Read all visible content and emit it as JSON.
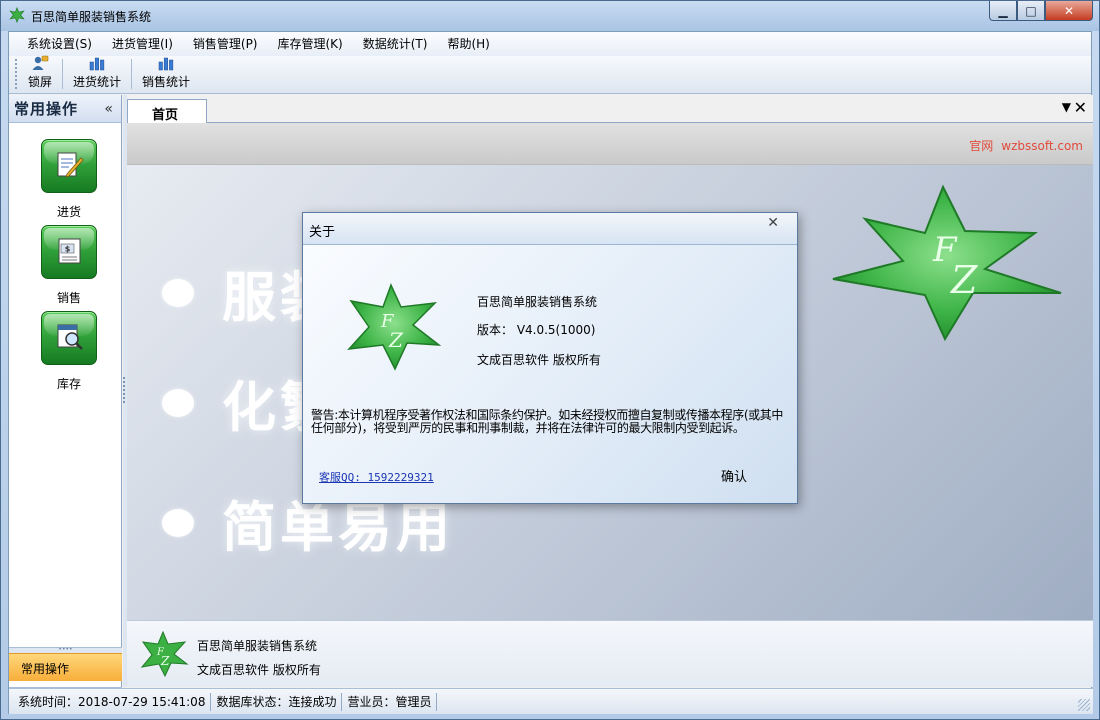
{
  "window": {
    "title": "百思简单服装销售系统",
    "min_glyph": "▁",
    "max_glyph": "□",
    "close_glyph": "✕"
  },
  "menu": [
    "系统设置(S)",
    "进货管理(I)",
    "销售管理(P)",
    "库存管理(K)",
    "数据统计(T)",
    "帮助(H)"
  ],
  "toolbar": {
    "lock": "锁屏",
    "purchase_stats": "进货统计",
    "sales_stats": "销售统计"
  },
  "left_panel": {
    "title": "常用操作",
    "collapse_glyph": "«",
    "items": [
      "进货",
      "销售",
      "库存"
    ],
    "active_section": "常用操作",
    "footer_glyph": "▾"
  },
  "tabs": {
    "home": "首页",
    "menu_glyph": "▼",
    "close_glyph": "✕"
  },
  "content": {
    "site_label": "官网",
    "site_url": "wzbssoft.com",
    "bullets": [
      "服装",
      "化繁",
      "简单易用"
    ]
  },
  "info": {
    "line1": "百思简单服装销售系统",
    "line2": "文成百思软件  版权所有"
  },
  "status": {
    "time": "系统时间：2018-07-29 15:41:08",
    "db": "数据库状态：连接成功",
    "operator": "营业员：管理员"
  },
  "dialog": {
    "title": "关于",
    "close_glyph": "✕",
    "product": "百思简单服装销售系统",
    "version": "版本： V4.0.5(1000)",
    "copyright": "文成百思软件  版权所有",
    "warning": "警告:本计算机程序受著作权法和国际条约保护。如未经授权而擅自复制或传播本程序(或其中任何部分)，将受到严厉的民事和刑事制裁，并将在法律许可的最大限制内受到起诉。",
    "qq": "客服QQ: 1592229321",
    "ok": "确认"
  }
}
